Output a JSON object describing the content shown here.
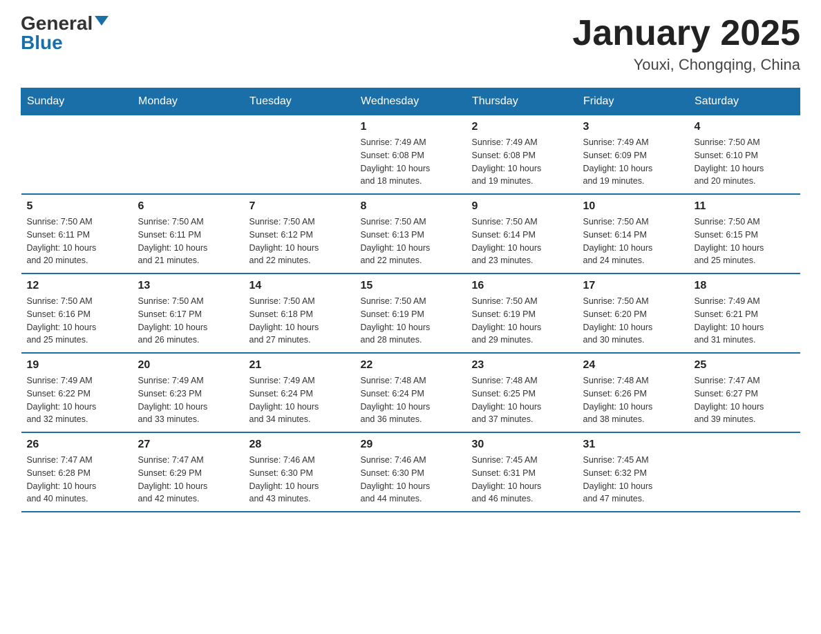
{
  "header": {
    "logo_general": "General",
    "logo_blue": "Blue",
    "month_title": "January 2025",
    "location": "Youxi, Chongqing, China"
  },
  "days_of_week": [
    "Sunday",
    "Monday",
    "Tuesday",
    "Wednesday",
    "Thursday",
    "Friday",
    "Saturday"
  ],
  "weeks": [
    [
      {
        "day": "",
        "info": ""
      },
      {
        "day": "",
        "info": ""
      },
      {
        "day": "",
        "info": ""
      },
      {
        "day": "1",
        "info": "Sunrise: 7:49 AM\nSunset: 6:08 PM\nDaylight: 10 hours\nand 18 minutes."
      },
      {
        "day": "2",
        "info": "Sunrise: 7:49 AM\nSunset: 6:08 PM\nDaylight: 10 hours\nand 19 minutes."
      },
      {
        "day": "3",
        "info": "Sunrise: 7:49 AM\nSunset: 6:09 PM\nDaylight: 10 hours\nand 19 minutes."
      },
      {
        "day": "4",
        "info": "Sunrise: 7:50 AM\nSunset: 6:10 PM\nDaylight: 10 hours\nand 20 minutes."
      }
    ],
    [
      {
        "day": "5",
        "info": "Sunrise: 7:50 AM\nSunset: 6:11 PM\nDaylight: 10 hours\nand 20 minutes."
      },
      {
        "day": "6",
        "info": "Sunrise: 7:50 AM\nSunset: 6:11 PM\nDaylight: 10 hours\nand 21 minutes."
      },
      {
        "day": "7",
        "info": "Sunrise: 7:50 AM\nSunset: 6:12 PM\nDaylight: 10 hours\nand 22 minutes."
      },
      {
        "day": "8",
        "info": "Sunrise: 7:50 AM\nSunset: 6:13 PM\nDaylight: 10 hours\nand 22 minutes."
      },
      {
        "day": "9",
        "info": "Sunrise: 7:50 AM\nSunset: 6:14 PM\nDaylight: 10 hours\nand 23 minutes."
      },
      {
        "day": "10",
        "info": "Sunrise: 7:50 AM\nSunset: 6:14 PM\nDaylight: 10 hours\nand 24 minutes."
      },
      {
        "day": "11",
        "info": "Sunrise: 7:50 AM\nSunset: 6:15 PM\nDaylight: 10 hours\nand 25 minutes."
      }
    ],
    [
      {
        "day": "12",
        "info": "Sunrise: 7:50 AM\nSunset: 6:16 PM\nDaylight: 10 hours\nand 25 minutes."
      },
      {
        "day": "13",
        "info": "Sunrise: 7:50 AM\nSunset: 6:17 PM\nDaylight: 10 hours\nand 26 minutes."
      },
      {
        "day": "14",
        "info": "Sunrise: 7:50 AM\nSunset: 6:18 PM\nDaylight: 10 hours\nand 27 minutes."
      },
      {
        "day": "15",
        "info": "Sunrise: 7:50 AM\nSunset: 6:19 PM\nDaylight: 10 hours\nand 28 minutes."
      },
      {
        "day": "16",
        "info": "Sunrise: 7:50 AM\nSunset: 6:19 PM\nDaylight: 10 hours\nand 29 minutes."
      },
      {
        "day": "17",
        "info": "Sunrise: 7:50 AM\nSunset: 6:20 PM\nDaylight: 10 hours\nand 30 minutes."
      },
      {
        "day": "18",
        "info": "Sunrise: 7:49 AM\nSunset: 6:21 PM\nDaylight: 10 hours\nand 31 minutes."
      }
    ],
    [
      {
        "day": "19",
        "info": "Sunrise: 7:49 AM\nSunset: 6:22 PM\nDaylight: 10 hours\nand 32 minutes."
      },
      {
        "day": "20",
        "info": "Sunrise: 7:49 AM\nSunset: 6:23 PM\nDaylight: 10 hours\nand 33 minutes."
      },
      {
        "day": "21",
        "info": "Sunrise: 7:49 AM\nSunset: 6:24 PM\nDaylight: 10 hours\nand 34 minutes."
      },
      {
        "day": "22",
        "info": "Sunrise: 7:48 AM\nSunset: 6:24 PM\nDaylight: 10 hours\nand 36 minutes."
      },
      {
        "day": "23",
        "info": "Sunrise: 7:48 AM\nSunset: 6:25 PM\nDaylight: 10 hours\nand 37 minutes."
      },
      {
        "day": "24",
        "info": "Sunrise: 7:48 AM\nSunset: 6:26 PM\nDaylight: 10 hours\nand 38 minutes."
      },
      {
        "day": "25",
        "info": "Sunrise: 7:47 AM\nSunset: 6:27 PM\nDaylight: 10 hours\nand 39 minutes."
      }
    ],
    [
      {
        "day": "26",
        "info": "Sunrise: 7:47 AM\nSunset: 6:28 PM\nDaylight: 10 hours\nand 40 minutes."
      },
      {
        "day": "27",
        "info": "Sunrise: 7:47 AM\nSunset: 6:29 PM\nDaylight: 10 hours\nand 42 minutes."
      },
      {
        "day": "28",
        "info": "Sunrise: 7:46 AM\nSunset: 6:30 PM\nDaylight: 10 hours\nand 43 minutes."
      },
      {
        "day": "29",
        "info": "Sunrise: 7:46 AM\nSunset: 6:30 PM\nDaylight: 10 hours\nand 44 minutes."
      },
      {
        "day": "30",
        "info": "Sunrise: 7:45 AM\nSunset: 6:31 PM\nDaylight: 10 hours\nand 46 minutes."
      },
      {
        "day": "31",
        "info": "Sunrise: 7:45 AM\nSunset: 6:32 PM\nDaylight: 10 hours\nand 47 minutes."
      },
      {
        "day": "",
        "info": ""
      }
    ]
  ]
}
